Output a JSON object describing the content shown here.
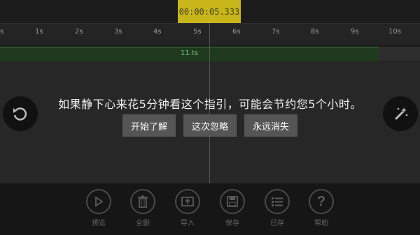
{
  "timecode": "00:00:05.333",
  "ruler": {
    "ticks": [
      "s",
      "1s",
      "2s",
      "3s",
      "4s",
      "5s",
      "6s",
      "7s",
      "8s",
      "9s",
      "10s"
    ]
  },
  "clip": {
    "name": "11.ts"
  },
  "guide": {
    "message": "如果静下心来花5分钟看这个指引，可能会节约您5个小时。",
    "buttons": {
      "start": "开始了解",
      "skip": "这次忽略",
      "never": "永远消失"
    }
  },
  "left_button": {
    "icon": "undo-icon"
  },
  "right_button": {
    "icon": "magic-wand-icon"
  },
  "toolbar": {
    "items": [
      {
        "label": "预览",
        "icon": "play-icon"
      },
      {
        "label": "全删",
        "icon": "trash-icon"
      },
      {
        "label": "导入",
        "icon": "import-icon"
      },
      {
        "label": "保存",
        "icon": "save-icon"
      },
      {
        "label": "已存",
        "icon": "list-icon"
      },
      {
        "label": "帮助",
        "icon": "help-icon"
      }
    ]
  },
  "colors": {
    "accent": "#c8b61a",
    "track": "#1f3a1f",
    "track_border": "#3b7a3b"
  }
}
